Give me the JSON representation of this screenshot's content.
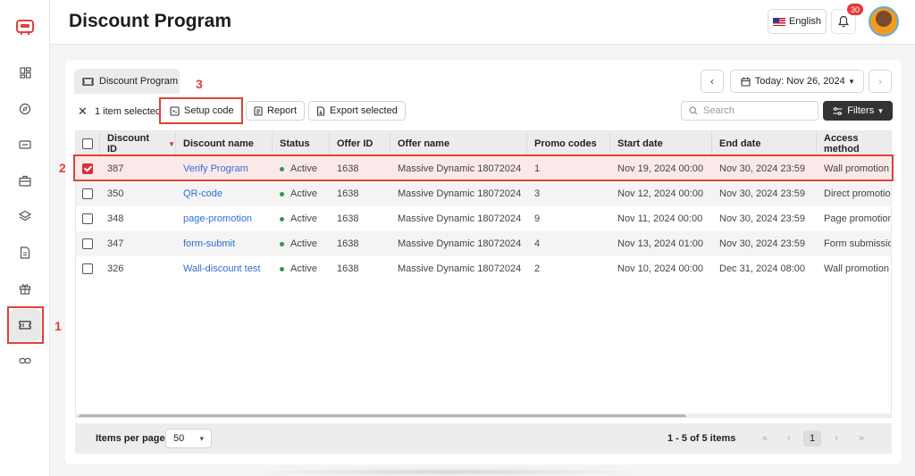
{
  "page": {
    "title": "Discount Program"
  },
  "header": {
    "language": "English",
    "notifications_count": "30"
  },
  "sidebar": {
    "icons": [
      "dashboard-icon",
      "compass-icon",
      "tickets-icon",
      "briefcase-icon",
      "layers-icon",
      "document-icon",
      "gift-icon",
      "ticket-icon",
      "link-icon"
    ],
    "active": "ticket-icon"
  },
  "tab": {
    "label": "Discount Program"
  },
  "date": {
    "label": "Today: Nov 26, 2024"
  },
  "toolbar": {
    "selected_text": "1 item selected",
    "setup_code": "Setup code",
    "report": "Report",
    "export_selected": "Export selected",
    "search_placeholder": "Search",
    "filters": "Filters"
  },
  "table": {
    "columns": [
      "Discount ID",
      "Discount name",
      "Status",
      "Offer ID",
      "Offer name",
      "Promo codes",
      "Start date",
      "End date",
      "Access method"
    ],
    "rows": [
      {
        "id": "387",
        "name": "Verify Program",
        "status": "Active",
        "offer_id": "1638",
        "offer_name": "Massive Dynamic 18072024",
        "promo": "1",
        "start": "Nov 19, 2024 00:00",
        "end": "Nov 30, 2024 23:59",
        "access": "Wall promotion",
        "checked": true
      },
      {
        "id": "350",
        "name": "QR-code",
        "status": "Active",
        "offer_id": "1638",
        "offer_name": "Massive Dynamic 18072024",
        "promo": "3",
        "start": "Nov 12, 2024 00:00",
        "end": "Nov 30, 2024 23:59",
        "access": "Direct promotion",
        "checked": false
      },
      {
        "id": "348",
        "name": "page-promotion",
        "status": "Active",
        "offer_id": "1638",
        "offer_name": "Massive Dynamic 18072024",
        "promo": "9",
        "start": "Nov 11, 2024 00:00",
        "end": "Nov 30, 2024 23:59",
        "access": "Page promotion",
        "checked": false
      },
      {
        "id": "347",
        "name": "form-submit",
        "status": "Active",
        "offer_id": "1638",
        "offer_name": "Massive Dynamic 18072024",
        "promo": "4",
        "start": "Nov 13, 2024 01:00",
        "end": "Nov 30, 2024 23:59",
        "access": "Form submission",
        "checked": false
      },
      {
        "id": "326",
        "name": "Wall-discount test",
        "status": "Active",
        "offer_id": "1638",
        "offer_name": "Massive Dynamic 18072024",
        "promo": "2",
        "start": "Nov 10, 2024 00:00",
        "end": "Dec 31, 2024 08:00",
        "access": "Wall promotion",
        "checked": false
      }
    ]
  },
  "footer": {
    "items_per_page_label": "Items per page:",
    "items_per_page_value": "50",
    "range_text": "1 - 5 of 5 items",
    "current_page": "1"
  },
  "annotations": {
    "step1": "1",
    "step2": "2",
    "step3": "3"
  },
  "colors": {
    "accent": "#d92f3a",
    "annotation": "#e0413a",
    "link": "#2f6fd1",
    "active_status": "#2e9a4e"
  }
}
